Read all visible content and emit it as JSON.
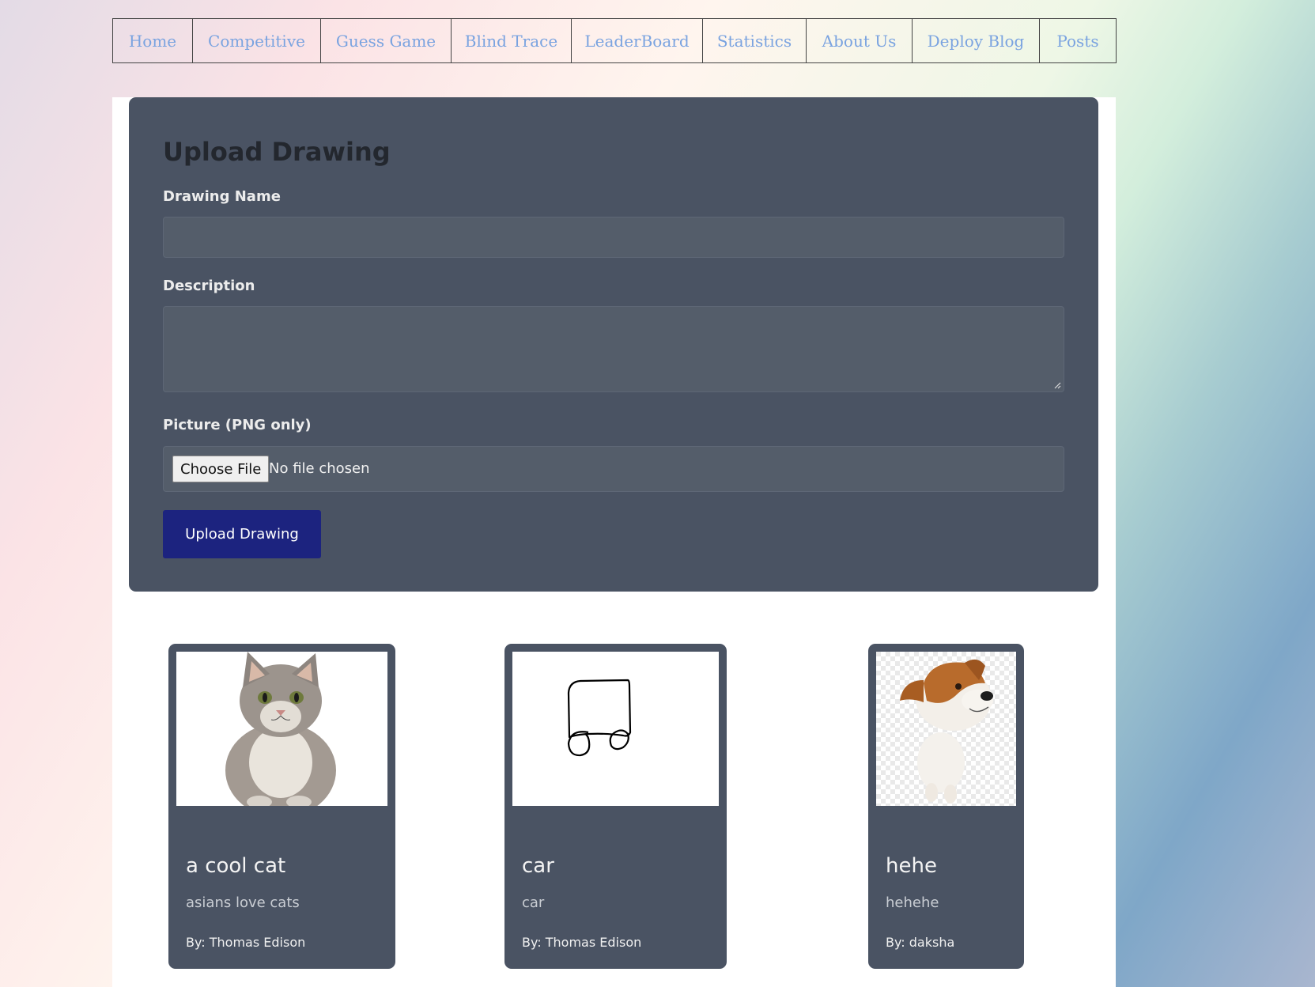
{
  "nav": {
    "items": [
      {
        "label": "Home"
      },
      {
        "label": "Competitive"
      },
      {
        "label": "Guess Game"
      },
      {
        "label": "Blind Trace"
      },
      {
        "label": "LeaderBoard"
      },
      {
        "label": "Statistics"
      },
      {
        "label": "About Us"
      },
      {
        "label": "Deploy Blog"
      },
      {
        "label": "Posts"
      }
    ]
  },
  "upload_form": {
    "title": "Upload Drawing",
    "name_label": "Drawing Name",
    "name_value": "",
    "description_label": "Description",
    "description_value": "",
    "picture_label": "Picture (PNG only)",
    "file_button": "Choose File",
    "file_status": "No file chosen",
    "submit_label": "Upload Drawing"
  },
  "drawings": [
    {
      "title": "a cool cat",
      "description": "asians love cats",
      "author": "By: Thomas Edison",
      "image": "cat-photo"
    },
    {
      "title": "car",
      "description": "car",
      "author": "By: Thomas Edison",
      "image": "car-sketch"
    },
    {
      "title": "hehe",
      "description": "hehehe",
      "author": "By: daksha",
      "image": "dog-photo"
    }
  ],
  "colors": {
    "panel": "#4a5363",
    "input": "#545d6a",
    "submit": "#1c237f",
    "nav_link": "#7aa3e0"
  }
}
